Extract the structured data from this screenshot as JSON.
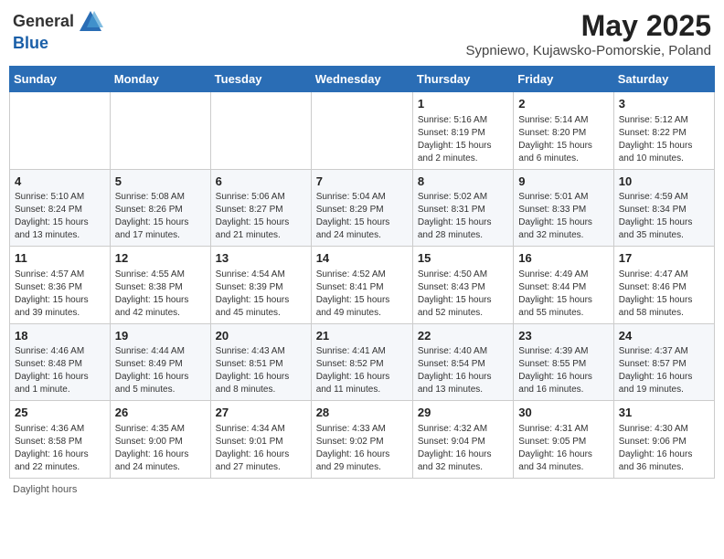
{
  "header": {
    "logo_general": "General",
    "logo_blue": "Blue",
    "title": "May 2025",
    "location": "Sypniewo, Kujawsko-Pomorskie, Poland"
  },
  "days_of_week": [
    "Sunday",
    "Monday",
    "Tuesday",
    "Wednesday",
    "Thursday",
    "Friday",
    "Saturday"
  ],
  "weeks": [
    [
      {
        "day": "",
        "info": ""
      },
      {
        "day": "",
        "info": ""
      },
      {
        "day": "",
        "info": ""
      },
      {
        "day": "",
        "info": ""
      },
      {
        "day": "1",
        "info": "Sunrise: 5:16 AM\nSunset: 8:19 PM\nDaylight: 15 hours\nand 2 minutes."
      },
      {
        "day": "2",
        "info": "Sunrise: 5:14 AM\nSunset: 8:20 PM\nDaylight: 15 hours\nand 6 minutes."
      },
      {
        "day": "3",
        "info": "Sunrise: 5:12 AM\nSunset: 8:22 PM\nDaylight: 15 hours\nand 10 minutes."
      }
    ],
    [
      {
        "day": "4",
        "info": "Sunrise: 5:10 AM\nSunset: 8:24 PM\nDaylight: 15 hours\nand 13 minutes."
      },
      {
        "day": "5",
        "info": "Sunrise: 5:08 AM\nSunset: 8:26 PM\nDaylight: 15 hours\nand 17 minutes."
      },
      {
        "day": "6",
        "info": "Sunrise: 5:06 AM\nSunset: 8:27 PM\nDaylight: 15 hours\nand 21 minutes."
      },
      {
        "day": "7",
        "info": "Sunrise: 5:04 AM\nSunset: 8:29 PM\nDaylight: 15 hours\nand 24 minutes."
      },
      {
        "day": "8",
        "info": "Sunrise: 5:02 AM\nSunset: 8:31 PM\nDaylight: 15 hours\nand 28 minutes."
      },
      {
        "day": "9",
        "info": "Sunrise: 5:01 AM\nSunset: 8:33 PM\nDaylight: 15 hours\nand 32 minutes."
      },
      {
        "day": "10",
        "info": "Sunrise: 4:59 AM\nSunset: 8:34 PM\nDaylight: 15 hours\nand 35 minutes."
      }
    ],
    [
      {
        "day": "11",
        "info": "Sunrise: 4:57 AM\nSunset: 8:36 PM\nDaylight: 15 hours\nand 39 minutes."
      },
      {
        "day": "12",
        "info": "Sunrise: 4:55 AM\nSunset: 8:38 PM\nDaylight: 15 hours\nand 42 minutes."
      },
      {
        "day": "13",
        "info": "Sunrise: 4:54 AM\nSunset: 8:39 PM\nDaylight: 15 hours\nand 45 minutes."
      },
      {
        "day": "14",
        "info": "Sunrise: 4:52 AM\nSunset: 8:41 PM\nDaylight: 15 hours\nand 49 minutes."
      },
      {
        "day": "15",
        "info": "Sunrise: 4:50 AM\nSunset: 8:43 PM\nDaylight: 15 hours\nand 52 minutes."
      },
      {
        "day": "16",
        "info": "Sunrise: 4:49 AM\nSunset: 8:44 PM\nDaylight: 15 hours\nand 55 minutes."
      },
      {
        "day": "17",
        "info": "Sunrise: 4:47 AM\nSunset: 8:46 PM\nDaylight: 15 hours\nand 58 minutes."
      }
    ],
    [
      {
        "day": "18",
        "info": "Sunrise: 4:46 AM\nSunset: 8:48 PM\nDaylight: 16 hours\nand 1 minute."
      },
      {
        "day": "19",
        "info": "Sunrise: 4:44 AM\nSunset: 8:49 PM\nDaylight: 16 hours\nand 5 minutes."
      },
      {
        "day": "20",
        "info": "Sunrise: 4:43 AM\nSunset: 8:51 PM\nDaylight: 16 hours\nand 8 minutes."
      },
      {
        "day": "21",
        "info": "Sunrise: 4:41 AM\nSunset: 8:52 PM\nDaylight: 16 hours\nand 11 minutes."
      },
      {
        "day": "22",
        "info": "Sunrise: 4:40 AM\nSunset: 8:54 PM\nDaylight: 16 hours\nand 13 minutes."
      },
      {
        "day": "23",
        "info": "Sunrise: 4:39 AM\nSunset: 8:55 PM\nDaylight: 16 hours\nand 16 minutes."
      },
      {
        "day": "24",
        "info": "Sunrise: 4:37 AM\nSunset: 8:57 PM\nDaylight: 16 hours\nand 19 minutes."
      }
    ],
    [
      {
        "day": "25",
        "info": "Sunrise: 4:36 AM\nSunset: 8:58 PM\nDaylight: 16 hours\nand 22 minutes."
      },
      {
        "day": "26",
        "info": "Sunrise: 4:35 AM\nSunset: 9:00 PM\nDaylight: 16 hours\nand 24 minutes."
      },
      {
        "day": "27",
        "info": "Sunrise: 4:34 AM\nSunset: 9:01 PM\nDaylight: 16 hours\nand 27 minutes."
      },
      {
        "day": "28",
        "info": "Sunrise: 4:33 AM\nSunset: 9:02 PM\nDaylight: 16 hours\nand 29 minutes."
      },
      {
        "day": "29",
        "info": "Sunrise: 4:32 AM\nSunset: 9:04 PM\nDaylight: 16 hours\nand 32 minutes."
      },
      {
        "day": "30",
        "info": "Sunrise: 4:31 AM\nSunset: 9:05 PM\nDaylight: 16 hours\nand 34 minutes."
      },
      {
        "day": "31",
        "info": "Sunrise: 4:30 AM\nSunset: 9:06 PM\nDaylight: 16 hours\nand 36 minutes."
      }
    ]
  ],
  "footer": "Daylight hours"
}
